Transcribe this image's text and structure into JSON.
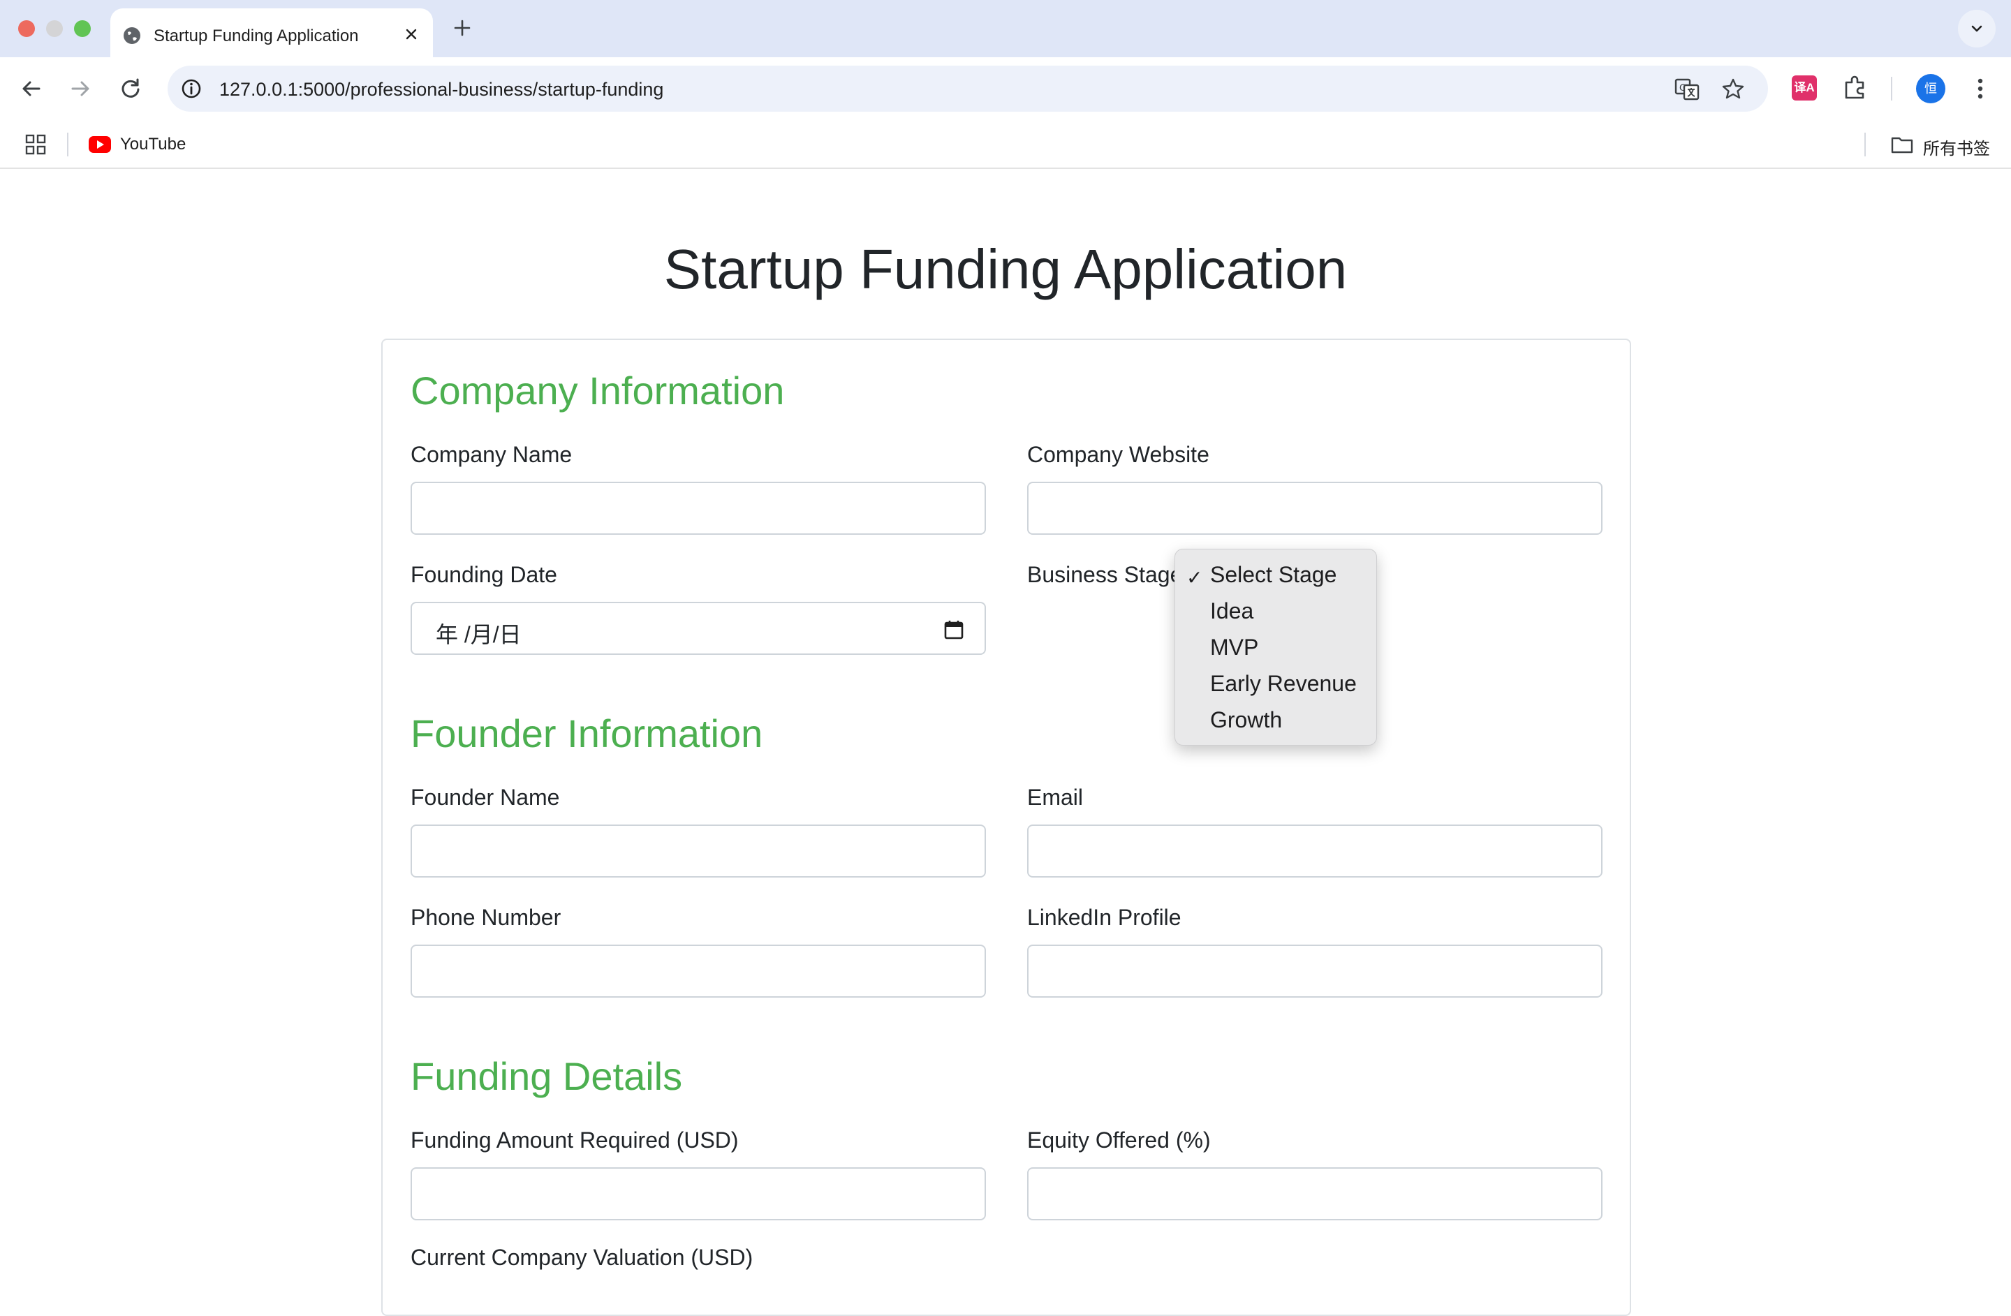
{
  "browser": {
    "tab_title": "Startup Funding Application",
    "url": "127.0.0.1:5000/professional-business/startup-funding",
    "bookmarks": [
      {
        "label": "YouTube"
      }
    ],
    "all_bookmarks_label": "所有书签",
    "profile_initial": "恒",
    "extension_label": "译A"
  },
  "page": {
    "title": "Startup Funding Application",
    "sections": {
      "company": {
        "title": "Company Information",
        "company_name_label": "Company Name",
        "company_website_label": "Company Website",
        "founding_date_label": "Founding Date",
        "founding_date_value": "年 /月/日",
        "business_stage_label": "Business Stage"
      },
      "founder": {
        "title": "Founder Information",
        "founder_name_label": "Founder Name",
        "email_label": "Email",
        "phone_label": "Phone Number",
        "linkedin_label": "LinkedIn Profile"
      },
      "funding": {
        "title": "Funding Details",
        "amount_label": "Funding Amount Required (USD)",
        "equity_label": "Equity Offered (%)",
        "valuation_label": "Current Company Valuation (USD)"
      }
    },
    "business_stage_dropdown": {
      "selected": "Select Stage",
      "options": [
        "Select Stage",
        "Idea",
        "MVP",
        "Early Revenue",
        "Growth"
      ]
    }
  },
  "colors": {
    "section_title": "#4caf50",
    "tab_strip": "#dfe6f7",
    "omnibox": "#edf1fa"
  }
}
